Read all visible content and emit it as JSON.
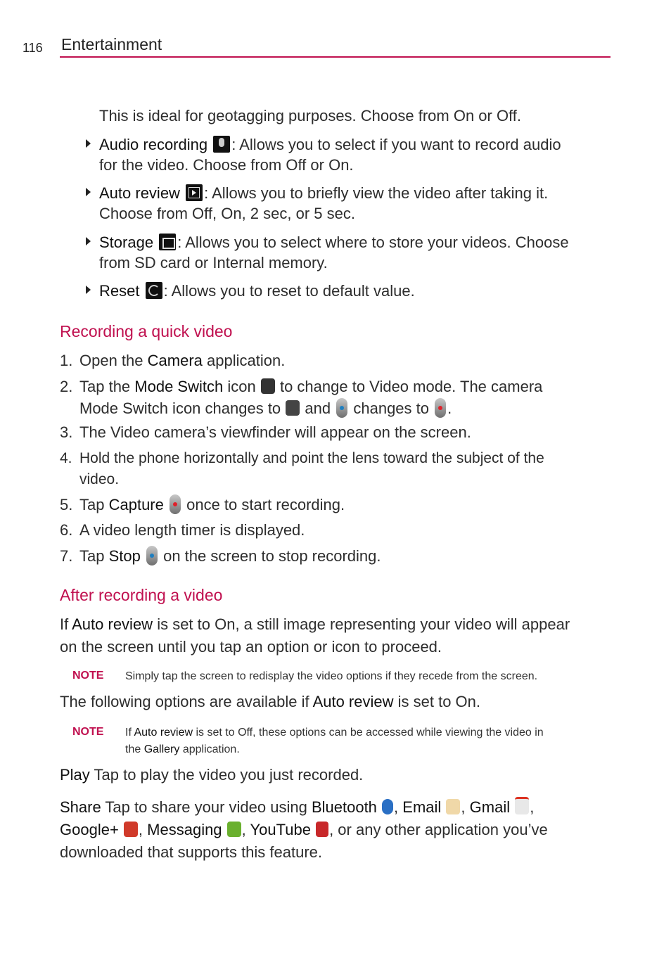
{
  "header": {
    "page_number": "116",
    "section": "Entertainment"
  },
  "intro_line": "This is ideal for geotagging purposes. Choose from On or Off.",
  "settings": [
    {
      "label": "Audio recording",
      "icon": "microphone-icon",
      "line1": ": Allows you to select if you want to record audio",
      "line2": "for the video. Choose from Off or On."
    },
    {
      "label": "Auto review",
      "icon": "play-icon",
      "line1": ": Allows you to briefly view the video after taking it.",
      "line2": "Choose from Off, On, 2 sec, or 5 sec."
    },
    {
      "label": "Storage",
      "icon": "sd-card-icon",
      "line1": ": Allows you to select where to store your videos. Choose",
      "line2": "from SD card or Internal memory."
    },
    {
      "label": "Reset",
      "icon": "reset-icon",
      "line1": ": Allows you to reset to default value.",
      "line2": ""
    }
  ],
  "recording": {
    "heading": "Recording a quick video",
    "steps": {
      "s1": {
        "num": "1.",
        "a": "Open the ",
        "b": "Camera",
        "c": " application."
      },
      "s2": {
        "num": "2.",
        "a": "Tap the ",
        "b": "Mode Switch",
        "c": " icon",
        "d": " to change to Video mode. The camera",
        "e": "Mode Switch icon changes to",
        "f": " and",
        "g": " changes to",
        "h": "."
      },
      "s3": {
        "num": "3.",
        "a": "The Video camera’s viewfinder will appear on the screen."
      },
      "s4": {
        "num": "4.",
        "a": "Hold the phone horizontally and point the lens toward the subject of the",
        "b": "video."
      },
      "s5": {
        "num": "5.",
        "a": "Tap ",
        "b": "Capture",
        "c": " once to start recording."
      },
      "s6": {
        "num": "6.",
        "a": "A video length timer is displayed."
      },
      "s7": {
        "num": "7.",
        "a": "Tap ",
        "b": "Stop",
        "c": " on the screen to stop recording."
      }
    }
  },
  "after": {
    "heading": "After recording a video",
    "p1a": "If ",
    "p1b": "Auto review",
    "p1c": " is set to On, a still image representing your video will appear",
    "p1d": "on the screen until you tap an option or icon to proceed.",
    "note1_label": "NOTE",
    "note1_text": "Simply tap the screen to redisplay the video options if they recede from the screen.",
    "p2a": "The following options are available if ",
    "p2b": "Auto review",
    "p2c": " is set to On.",
    "note2_label": "NOTE",
    "note2_a": "If ",
    "note2_b": "Auto review",
    "note2_c": " is set to Off, these options can be accessed while viewing the video in",
    "note2_d": "the ",
    "note2_e": "Gallery",
    "note2_f": " application.",
    "play_label": "Play",
    "play_text": " Tap to play the video you just recorded.",
    "share_label": "Share",
    "share_text": " Tap to share your video using ",
    "apps": {
      "bluetooth": "Bluetooth",
      "email": "Email",
      "gmail": "Gmail",
      "googleplus": "Google+",
      "messaging": "Messaging",
      "youtube": "YouTube"
    },
    "share_tail": ", or any other application you’ve",
    "share_end": "downloaded that supports this feature."
  },
  "colors": {
    "accent": "#c0104f"
  }
}
